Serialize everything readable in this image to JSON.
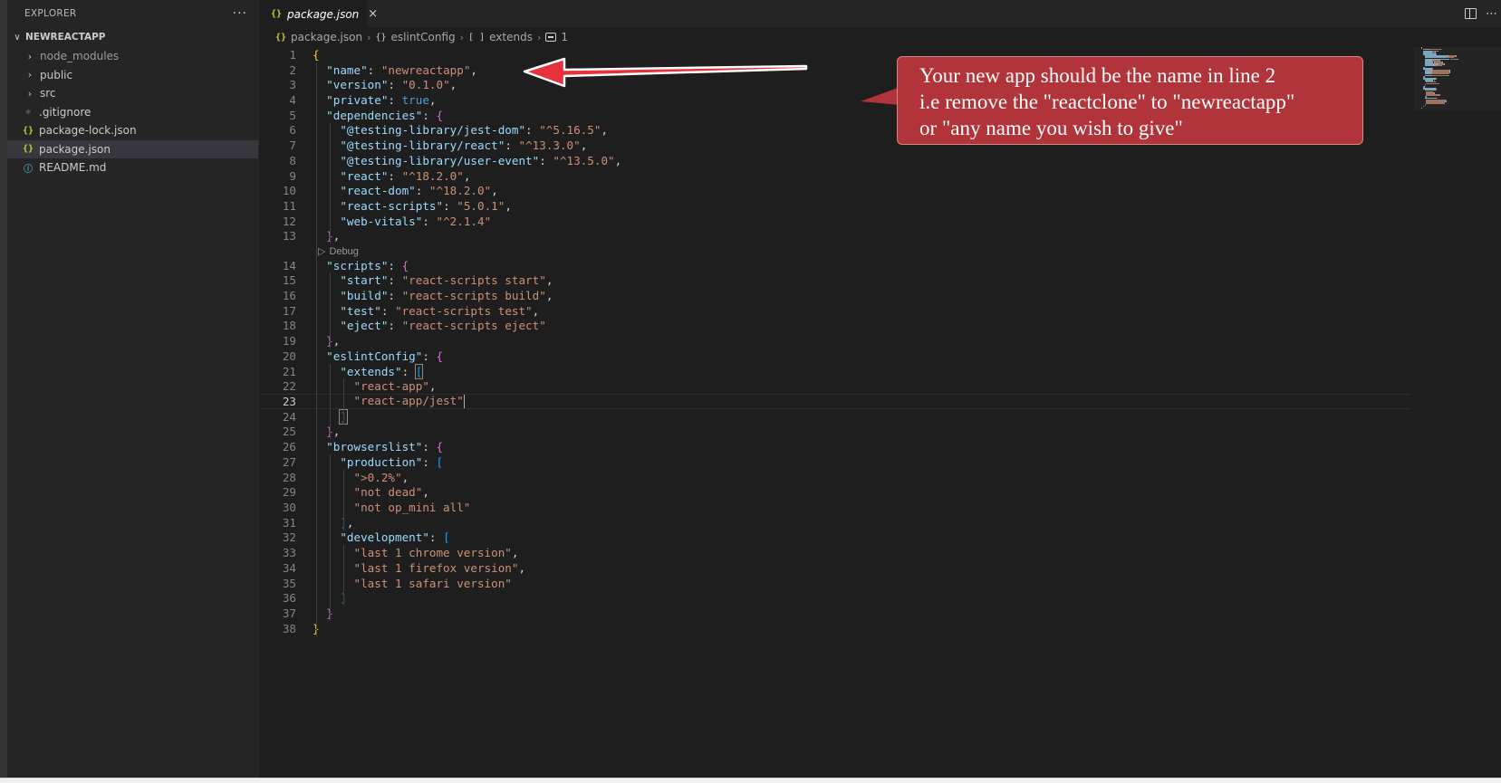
{
  "sidebar": {
    "title": "EXPLORER",
    "more_label": "···",
    "section": {
      "chevron": "∨",
      "label": "NEWREACTAPP"
    },
    "items": [
      {
        "label": "node_modules",
        "kind": "folder",
        "icon": "chevron-right-icon"
      },
      {
        "label": "public",
        "kind": "folder",
        "icon": "chevron-right-icon"
      },
      {
        "label": "src",
        "kind": "folder",
        "icon": "chevron-right-icon"
      },
      {
        "label": ".gitignore",
        "kind": "file",
        "icon": "git-file-icon",
        "glyph": "◆"
      },
      {
        "label": "package-lock.json",
        "kind": "file",
        "icon": "json-file-icon",
        "glyph": "{}"
      },
      {
        "label": "package.json",
        "kind": "file",
        "icon": "json-file-icon",
        "glyph": "{}",
        "selected": true
      },
      {
        "label": "README.md",
        "kind": "file",
        "icon": "info-file-icon",
        "glyph": "ⓘ"
      }
    ]
  },
  "editor": {
    "tab": {
      "glyph": "{}",
      "label": "package.json",
      "close": "×"
    },
    "breadcrumb": {
      "file_glyph": "{}",
      "file": "package.json",
      "obj_glyph": "{}",
      "obj": "eslintConfig",
      "arr_glyph": "[ ]",
      "arr": "extends",
      "num": "1"
    },
    "codelens": "Debug",
    "current_line": 23,
    "lines": [
      [
        [
          "br1",
          "{"
        ]
      ],
      [
        [
          "k",
          "  \"name\""
        ],
        [
          "p",
          ": "
        ],
        [
          "s",
          "\"newreactapp\""
        ],
        [
          "p",
          ","
        ]
      ],
      [
        [
          "k",
          "  \"version\""
        ],
        [
          "p",
          ": "
        ],
        [
          "s",
          "\"0.1.0\""
        ],
        [
          "p",
          ","
        ]
      ],
      [
        [
          "k",
          "  \"private\""
        ],
        [
          "p",
          ": "
        ],
        [
          "b",
          "true"
        ],
        [
          "p",
          ","
        ]
      ],
      [
        [
          "k",
          "  \"dependencies\""
        ],
        [
          "p",
          ": "
        ],
        [
          "br2",
          "{"
        ]
      ],
      [
        [
          "k",
          "    \"@testing-library/jest-dom\""
        ],
        [
          "p",
          ": "
        ],
        [
          "s",
          "\"^5.16.5\""
        ],
        [
          "p",
          ","
        ]
      ],
      [
        [
          "k",
          "    \"@testing-library/react\""
        ],
        [
          "p",
          ": "
        ],
        [
          "s",
          "\"^13.3.0\""
        ],
        [
          "p",
          ","
        ]
      ],
      [
        [
          "k",
          "    \"@testing-library/user-event\""
        ],
        [
          "p",
          ": "
        ],
        [
          "s",
          "\"^13.5.0\""
        ],
        [
          "p",
          ","
        ]
      ],
      [
        [
          "k",
          "    \"react\""
        ],
        [
          "p",
          ": "
        ],
        [
          "s",
          "\"^18.2.0\""
        ],
        [
          "p",
          ","
        ]
      ],
      [
        [
          "k",
          "    \"react-dom\""
        ],
        [
          "p",
          ": "
        ],
        [
          "s",
          "\"^18.2.0\""
        ],
        [
          "p",
          ","
        ]
      ],
      [
        [
          "k",
          "    \"react-scripts\""
        ],
        [
          "p",
          ": "
        ],
        [
          "s",
          "\"5.0.1\""
        ],
        [
          "p",
          ","
        ]
      ],
      [
        [
          "k",
          "    \"web-vitals\""
        ],
        [
          "p",
          ": "
        ],
        [
          "s",
          "\"^2.1.4\""
        ]
      ],
      [
        [
          "br2",
          "  }"
        ],
        [
          "p",
          ","
        ]
      ],
      [
        [
          "k",
          "  \"scripts\""
        ],
        [
          "p",
          ": "
        ],
        [
          "br2",
          "{"
        ]
      ],
      [
        [
          "k",
          "    \"start\""
        ],
        [
          "p",
          ": "
        ],
        [
          "s",
          "\"react-scripts start\""
        ],
        [
          "p",
          ","
        ]
      ],
      [
        [
          "k",
          "    \"build\""
        ],
        [
          "p",
          ": "
        ],
        [
          "s",
          "\"react-scripts build\""
        ],
        [
          "p",
          ","
        ]
      ],
      [
        [
          "k",
          "    \"test\""
        ],
        [
          "p",
          ": "
        ],
        [
          "s",
          "\"react-scripts test\""
        ],
        [
          "p",
          ","
        ]
      ],
      [
        [
          "k",
          "    \"eject\""
        ],
        [
          "p",
          ": "
        ],
        [
          "s",
          "\"react-scripts eject\""
        ]
      ],
      [
        [
          "br2",
          "  }"
        ],
        [
          "p",
          ","
        ]
      ],
      [
        [
          "k",
          "  \"eslintConfig\""
        ],
        [
          "p",
          ": "
        ],
        [
          "br2",
          "{"
        ]
      ],
      [
        [
          "k",
          "    \"extends\""
        ],
        [
          "p",
          ": "
        ],
        [
          "br3hl",
          "["
        ]
      ],
      [
        [
          "s",
          "      \"react-app\""
        ],
        [
          "p",
          ","
        ]
      ],
      [
        [
          "s",
          "      \"react-app/jest\""
        ],
        [
          "cursor",
          ""
        ]
      ],
      [
        [
          "p",
          "    "
        ],
        [
          "br3hl",
          "]"
        ]
      ],
      [
        [
          "br2",
          "  }"
        ],
        [
          "p",
          ","
        ]
      ],
      [
        [
          "k",
          "  \"browserslist\""
        ],
        [
          "p",
          ": "
        ],
        [
          "br2",
          "{"
        ]
      ],
      [
        [
          "k",
          "    \"production\""
        ],
        [
          "p",
          ": "
        ],
        [
          "br3",
          "["
        ]
      ],
      [
        [
          "s",
          "      \">0.2%\""
        ],
        [
          "p",
          ","
        ]
      ],
      [
        [
          "s",
          "      \"not dead\""
        ],
        [
          "p",
          ","
        ]
      ],
      [
        [
          "s",
          "      \"not op_mini all\""
        ]
      ],
      [
        [
          "br3",
          "    ]"
        ],
        [
          "p",
          ","
        ]
      ],
      [
        [
          "k",
          "    \"development\""
        ],
        [
          "p",
          ": "
        ],
        [
          "br3",
          "["
        ]
      ],
      [
        [
          "s",
          "      \"last 1 chrome version\""
        ],
        [
          "p",
          ","
        ]
      ],
      [
        [
          "s",
          "      \"last 1 firefox version\""
        ],
        [
          "p",
          ","
        ]
      ],
      [
        [
          "s",
          "      \"last 1 safari version\""
        ]
      ],
      [
        [
          "br3",
          "    ]"
        ]
      ],
      [
        [
          "br2",
          "  }"
        ]
      ],
      [
        [
          "br1",
          "}"
        ]
      ]
    ]
  },
  "annotation": {
    "text": "Your new app should be the name in line 2\ni.e remove the \"reactclone\" to \"newreactapp\"\nor \"any name you wish to give\"",
    "box_color": "#b1343a",
    "arrow_color": "#e5323b"
  },
  "colors": {
    "editor_bg": "#1e1e1e",
    "sidebar_bg": "#252526",
    "key": "#9cdcfe",
    "string": "#ce9178",
    "keyword": "#569cd6"
  }
}
